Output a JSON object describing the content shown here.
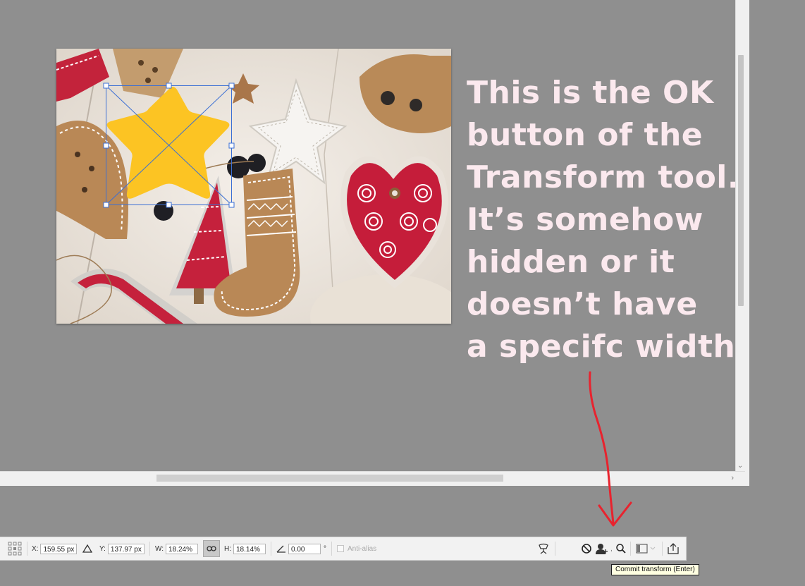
{
  "annotation": {
    "lines": [
      "This is the OK",
      "button of the",
      "Transform tool.",
      "It’s somehow",
      "hidden or it",
      "doesn’t have",
      "a specifc width"
    ]
  },
  "options_bar": {
    "x_label": "X:",
    "x_value": "159.55 px",
    "y_label": "Y:",
    "y_value": "137.97 px",
    "w_label": "W:",
    "w_value": "18.24%",
    "h_label": "H:",
    "h_value": "18.14%",
    "angle_value": "0.00",
    "degree_symbol": "°",
    "anti_alias_label": "Anti-alias"
  },
  "tooltip": {
    "text": "Commit transform (Enter)"
  },
  "colors": {
    "canvas_background": "#8f8f8f",
    "star_fill": "#fcc423",
    "annotation_text": "#fbe9ee",
    "arrow": "#e8232e",
    "tooltip_background": "#ffffe1"
  }
}
